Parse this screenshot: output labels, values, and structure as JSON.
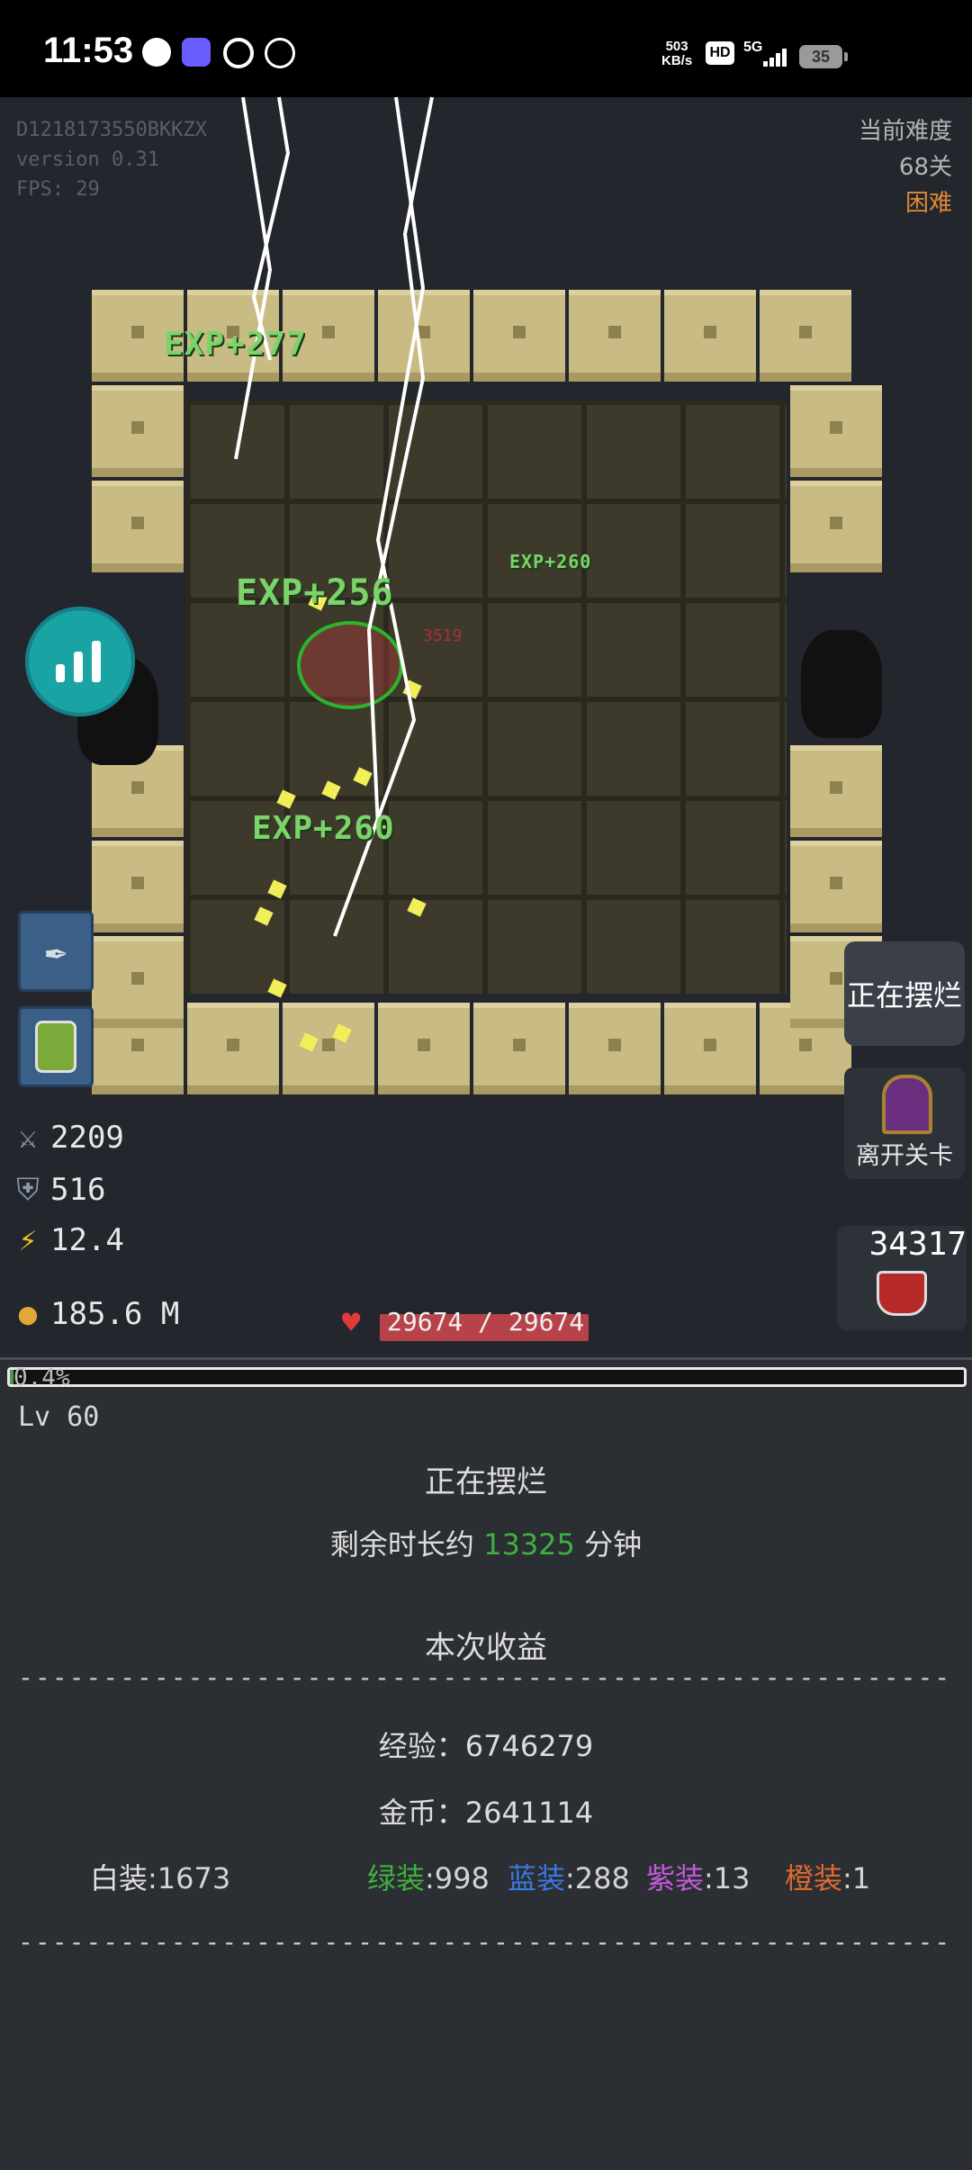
{
  "status_bar": {
    "time": "11:53",
    "net_speed_value": "503",
    "net_speed_unit": "KB/s",
    "hd_label": "HD",
    "network": "5G",
    "battery": "35"
  },
  "debug": {
    "device_id": "D1218173550BKKZX",
    "version": "version 0.31",
    "fps": "FPS: 29"
  },
  "difficulty": {
    "label": "当前难度",
    "stage": "68关",
    "level": "困难"
  },
  "exp_popups": [
    "EXP+277",
    "EXP+256",
    "EXP+260",
    "EXP+260"
  ],
  "damage_popup": "3519",
  "stats": {
    "attack": "2209",
    "defense": "516",
    "speed": "12.4",
    "gold": "185.6 M"
  },
  "hp": {
    "text": "29674 / 29674",
    "fraction": 1.0
  },
  "buttons": {
    "idle": "正在摆烂",
    "leave": "离开关卡",
    "potion_count": "34317"
  },
  "panel": {
    "xp_percent_text": "0.4%",
    "xp_fraction": 0.004,
    "level": "Lv 60",
    "status_title": "正在摆烂",
    "remaining_prefix": "剩余时长约",
    "remaining_value": "13325",
    "remaining_suffix": "分钟",
    "earnings_title": "本次收益",
    "exp_label": "经验：",
    "exp_value": "6746279",
    "gold_label": "金币：",
    "gold_value": "2641114",
    "loot": {
      "white_label": "白装",
      "white_value": ":1673",
      "green_label": "绿装",
      "green_value": ":998",
      "blue_label": "蓝装",
      "blue_value": ":288",
      "purple_label": "紫装",
      "purple_value": ":13",
      "orange_label": "橙装",
      "orange_value": ":1"
    },
    "divider": "------------------------------------------------------------"
  },
  "colors": {
    "background": "#23262d",
    "hard": "#e08a32",
    "exp_green": "#7bd36a",
    "hp_red": "#b8424a",
    "stats_button": "#1aa3a3"
  },
  "icons": [
    "sword-icon",
    "shield-icon",
    "lightning-icon",
    "coin-icon",
    "heart-icon",
    "bar-chart-icon",
    "feather-icon",
    "jar-icon",
    "portal-icon",
    "potion-icon"
  ]
}
